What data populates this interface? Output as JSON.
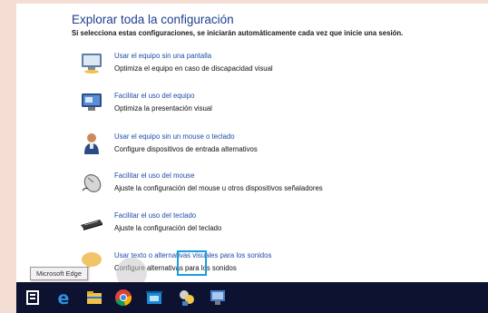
{
  "panel": {
    "title": "Explorar toda la configuración",
    "subtitle": "Si selecciona estas configuraciones, se iniciarán automáticamente cada vez que inicie una sesión."
  },
  "options": [
    {
      "link": "Usar el equipo sin una pantalla",
      "desc": "Optimiza el equipo en caso de discapacidad visual",
      "icon": "monitor-icon"
    },
    {
      "link": "Facilitar el uso del equipo",
      "desc": "Optimiza la presentación visual",
      "icon": "display-icon"
    },
    {
      "link": "Usar el equipo sin un mouse o teclado",
      "desc": "Configure dispositivos de entrada alternativos",
      "icon": "person-icon"
    },
    {
      "link": "Facilitar el uso del mouse",
      "desc": "Ajuste la configuración del mouse u otros dispositivos señaladores",
      "icon": "mouse-icon"
    },
    {
      "link": "Facilitar el uso del teclado",
      "desc": "Ajuste la configuración del teclado",
      "icon": "keyboard-icon"
    },
    {
      "link": "Usar texto o alternativas visuales para los sonidos",
      "desc": "Configure alternativas para los sonidos",
      "icon": "speech-bubble-icon"
    }
  ],
  "tooltip": "Microsoft Edge",
  "taskbar": {
    "items": [
      "task-view-icon",
      "edge-icon",
      "file-explorer-icon",
      "chrome-icon",
      "store-icon",
      "network-icon",
      "control-panel-icon"
    ]
  },
  "colors": {
    "link": "#1f4ea8",
    "heading": "#1e3f8f",
    "taskbar": "#0c1230",
    "highlight": "#1a9ee0",
    "background": "#f4ddd3"
  }
}
